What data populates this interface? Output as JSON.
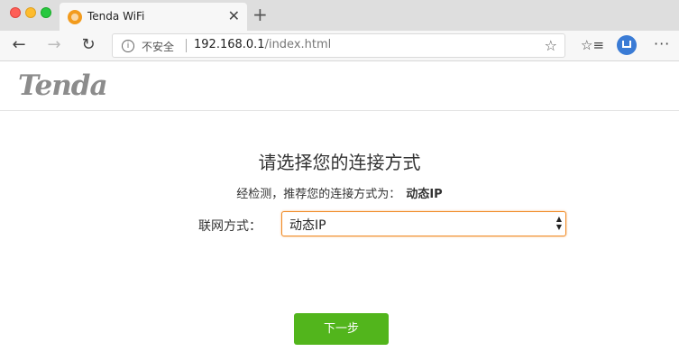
{
  "browser": {
    "tab_title": "Tenda WiFi",
    "tab_close": "✕",
    "new_tab": "+",
    "security_label": "不安全",
    "url_host": "192.168.0.1",
    "url_path": "/index.html",
    "icons": [
      "back-arrow-icon",
      "forward-arrow-icon",
      "reload-icon",
      "info-icon",
      "star-icon",
      "favorites-icon",
      "profile-icon",
      "more-menu-icon"
    ]
  },
  "page": {
    "logo": "Tenda",
    "heading": "请选择您的连接方式",
    "recommend_text": "经检测，推荐您的连接方式为：",
    "recommend_value": "动态IP",
    "connection_label": "联网方式：",
    "connection_selected": "动态IP",
    "next_button": "下一步"
  },
  "colors": {
    "accent_orange": "#f08a24",
    "button_green": "#52b51c",
    "logo_gray": "#8c8c8c"
  }
}
